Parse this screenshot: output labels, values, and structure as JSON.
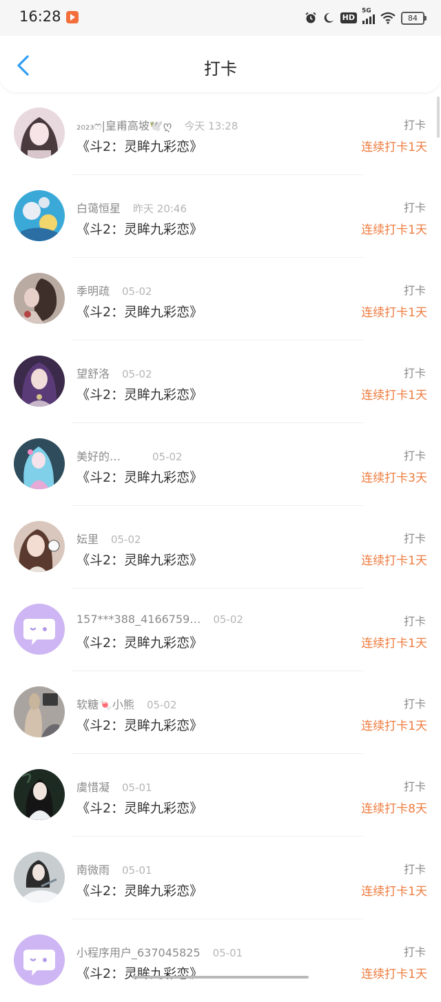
{
  "status_bar": {
    "time": "16:28",
    "network": "5G",
    "hd": "HD",
    "battery": "84",
    "icons": [
      "app-notification-icon",
      "alarm-icon",
      "moon-icon",
      "hd-icon",
      "signal-icon",
      "wifi-icon",
      "battery-icon"
    ]
  },
  "nav": {
    "title": "打卡",
    "back_icon": "chevron-left-icon"
  },
  "colors": {
    "accent_blue": "#2f9ef5",
    "streak_orange": "#ee7b3e",
    "default_avatar_purple": "#cdb6f3"
  },
  "entries": [
    {
      "name": "₂₀₂₃ෆ|皇甫高坡🕊️ღ",
      "date": "今天 13:28",
      "book": "《斗2：灵眸九彩恋》",
      "action": "打卡",
      "streak": "连续打卡1天"
    },
    {
      "name": "白蔼恒星",
      "date": "昨天 20:46",
      "book": "《斗2：灵眸九彩恋》",
      "action": "打卡",
      "streak": "连续打卡1天"
    },
    {
      "name": "季明疏",
      "date": "05-02",
      "book": "《斗2：灵眸九彩恋》",
      "action": "打卡",
      "streak": "连续打卡1天"
    },
    {
      "name": "望舒洛",
      "date": "05-02",
      "book": "《斗2：灵眸九彩恋》",
      "action": "打卡",
      "streak": "连续打卡1天"
    },
    {
      "name": "美好的…",
      "date": "05-02",
      "book": "《斗2：灵眸九彩恋》",
      "action": "打卡",
      "streak": "连续打卡3天"
    },
    {
      "name": "妘里",
      "date": "05-02",
      "book": "《斗2：灵眸九彩恋》",
      "action": "打卡",
      "streak": "连续打卡1天"
    },
    {
      "name": "157***388_4166759…",
      "date": "05-02",
      "book": "《斗2：灵眸九彩恋》",
      "action": "打卡",
      "streak": "连续打卡1天"
    },
    {
      "name": "软糖🍬小熊",
      "date": "05-02",
      "book": "《斗2：灵眸九彩恋》",
      "action": "打卡",
      "streak": "连续打卡1天"
    },
    {
      "name": "虞惜凝",
      "date": "05-01",
      "book": "《斗2：灵眸九彩恋》",
      "action": "打卡",
      "streak": "连续打卡8天"
    },
    {
      "name": "南微雨",
      "date": "05-01",
      "book": "《斗2：灵眸九彩恋》",
      "action": "打卡",
      "streak": "连续打卡1天"
    },
    {
      "name": "小程序用户_637045825",
      "date": "05-01",
      "book": "《斗2：灵眸九彩恋》",
      "action": "打卡",
      "streak": "连续打卡1天"
    }
  ]
}
